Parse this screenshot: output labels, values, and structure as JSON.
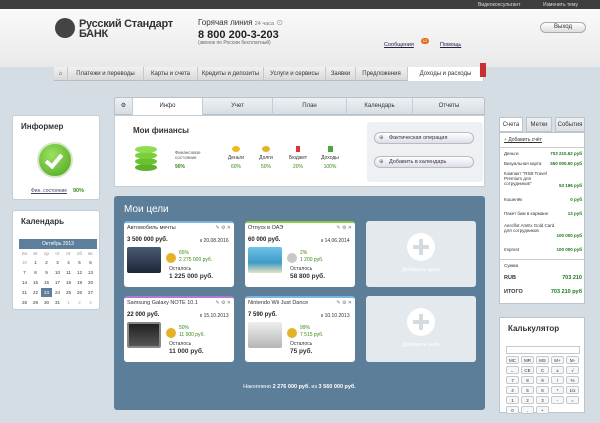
{
  "topbar": {
    "consultant": "Видеоконсультант",
    "change_theme": "Изменить тему"
  },
  "header": {
    "bank_name_1": "Русский Стандарт",
    "bank_name_2": "БАНК",
    "hotline_label": "Горячая линия",
    "hotline_hours": "24 часа",
    "phone": "8 800 200-3-203",
    "phone_note": "(звонок по России бесплатный)",
    "exit": "Выход",
    "messages": "Сообщения",
    "messages_count": "12",
    "help": "Помощь"
  },
  "nav": {
    "items": [
      "Платежи и переводы",
      "Карты и счета",
      "Кредиты и депозиты",
      "Услуги и сервисы",
      "Заявки",
      "Предложения",
      "Доходы и расходы"
    ]
  },
  "informer": {
    "title": "Информер",
    "status_label": "Фин. состояние",
    "status_value": "90%"
  },
  "calendar": {
    "title": "Календарь",
    "month": "Октябрь 2013",
    "days": [
      "пн",
      "вт",
      "ср",
      "чт",
      "пт",
      "сб",
      "вс"
    ],
    "cells": [
      "30",
      "1",
      "2",
      "3",
      "4",
      "5",
      "6",
      "7",
      "8",
      "9",
      "10",
      "11",
      "12",
      "13",
      "14",
      "15",
      "16",
      "17",
      "18",
      "19",
      "20",
      "21",
      "22",
      "23",
      "24",
      "25",
      "26",
      "27",
      "28",
      "29",
      "30",
      "31",
      "1",
      "2",
      "3"
    ]
  },
  "tabs": [
    "Инфо",
    "Учет",
    "План",
    "Календарь",
    "Отчеты"
  ],
  "finances": {
    "title": "Мои финансы",
    "state_label": "Финансовое состояние",
    "state_value": "90%",
    "items": [
      {
        "label": "Деньги",
        "value": "60%"
      },
      {
        "label": "Долги",
        "value": "50%"
      },
      {
        "label": "Бюджет",
        "value": "20%"
      },
      {
        "label": "Доходы",
        "value": "100%"
      }
    ],
    "btn_operation": "Фактическая операция",
    "btn_calendar": "Добавить в календарь"
  },
  "goals": {
    "title": "Мои цели",
    "add_label": "Добавить цель",
    "remaining_label": "Осталось",
    "items": [
      {
        "name": "Автомобиль мечты",
        "total": "3 500 000 руб.",
        "date": "к 20.08.2016",
        "percent": "65%",
        "saved": "2 275 000 руб.",
        "remaining": "1 225 000 руб."
      },
      {
        "name": "Отпуск в ОАЭ",
        "total": "60 000 руб.",
        "date": "к 14.06.2014",
        "percent": "2%",
        "saved": "1 200 руб.",
        "remaining": "58 800 руб."
      },
      {
        "name": "Samsung Galaxy NOTE 10.1",
        "total": "22 000 руб.",
        "date": "к 15.10.2013",
        "percent": "50%",
        "saved": "11 000 руб.",
        "remaining": "11 000 руб."
      },
      {
        "name": "Nintendo Wii Just Dance",
        "total": "7 590 руб.",
        "date": "к 10.10.2013",
        "percent": "99%",
        "saved": "7 515 руб.",
        "remaining": "75 руб."
      }
    ],
    "summary_prefix": "Накоплено",
    "summary_saved": "2 276 000 руб.",
    "summary_mid": "из",
    "summary_total": "3 560 000 руб."
  },
  "accounts": {
    "tabs": [
      "Счета",
      "Метки",
      "События"
    ],
    "add": "Добавить счёт",
    "money_header": "Деньги",
    "money_total": "703 210.62 руб",
    "rows": [
      {
        "name": "Визуальная карта",
        "value": "550 000.50 руб"
      },
      {
        "name": "Компакт \"RSB Travel Premium для сотрудников\"",
        "value": "53 196 руб"
      },
      {
        "name": "Кошелёк",
        "value": "0 руб"
      },
      {
        "name": "Пакет бим в кармане",
        "value": "13 руб"
      },
      {
        "name": "Aeroflot AmEx Gold Card для сотрудников",
        "value": "100 000 руб"
      },
      {
        "name": "Imprest",
        "value": "100 000 руб"
      }
    ],
    "sum_header": "Сумма",
    "rub_label": "RUB",
    "rub_value": "703 210",
    "total_label": "ИТОГО",
    "total_value": "703 210 руб"
  },
  "calculator": {
    "title": "Калькулятор",
    "keys": [
      "MC",
      "MR",
      "MS",
      "M+",
      "M-",
      "←",
      "CE",
      "C",
      "±",
      "√",
      "7",
      "8",
      "9",
      "/",
      "%",
      "4",
      "5",
      "6",
      "*",
      "1/x",
      "1",
      "2",
      "3",
      "-",
      "=",
      "0",
      ",",
      "+"
    ]
  },
  "colors": {
    "accent_green": "#62b32d",
    "blue_panel": "#5c7e99",
    "orange": "#e46b1c",
    "red": "#c73030"
  }
}
